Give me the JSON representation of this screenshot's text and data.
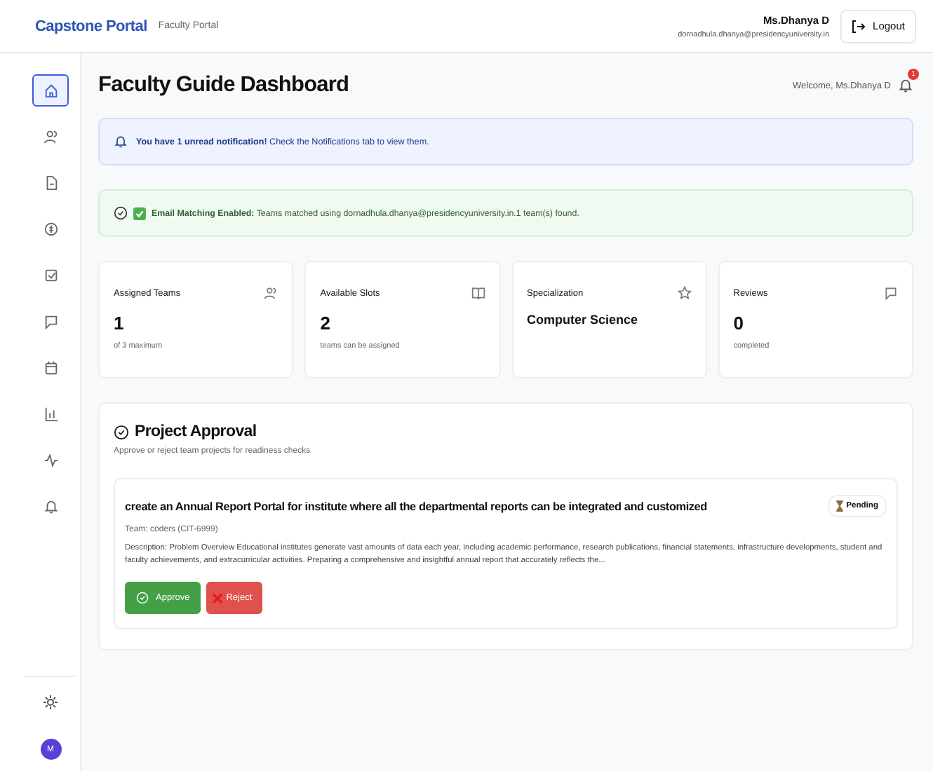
{
  "header": {
    "brand": "Capstone Portal",
    "subtitle": "Faculty Portal",
    "user_name": "Ms.Dhanya D",
    "user_email": "dornadhula.dhanya@presidencyuniversity.in",
    "logout": "Logout"
  },
  "sidebar": {
    "items": [
      {
        "selected": true
      },
      {
        "selected": false
      },
      {
        "selected": false
      },
      {
        "selected": false
      },
      {
        "selected": false
      },
      {
        "selected": false
      },
      {
        "selected": false
      },
      {
        "selected": false
      },
      {
        "selected": false
      },
      {
        "selected": false
      }
    ],
    "avatar": "M"
  },
  "page": {
    "title": "Faculty Guide Dashboard",
    "welcome": "Welcome, Ms.Dhanya D",
    "notification_count": "1"
  },
  "notice": {
    "text": "**You have 1 unread notification!** Check the Notifications tab to view them."
  },
  "email_banner": {
    "text": "**Email Matching Enabled:** Teams matched using dornadhula.dhanya@presidencyuniversity.in.1 team(s) found."
  },
  "stats": [
    {
      "label": "Assigned Teams",
      "value": "1",
      "note": "of 3 maximum"
    },
    {
      "label": "Available Slots",
      "value": "2",
      "note": "teams can be assigned"
    },
    {
      "label": "Specialization",
      "value": "Computer Science"
    },
    {
      "label": "Reviews",
      "value": "0",
      "note": "completed"
    }
  ],
  "approval": {
    "title": "Project Approval",
    "subtitle": "Approve or reject team projects for readiness checks",
    "projects": [
      {
        "title": "create an Annual Report Portal for institute where all the departmental reports can be integrated and customized",
        "status": "Pending",
        "team": "Team: coders (CIT-6999)",
        "description": "Description: Problem Overview Educational institutes generate vast amounts of data each year, including academic performance, research publications, financial statements, infrastructure developments, student and faculty achievements, and extracurricular activities. Preparing a comprehensive and insightful annual report that accurately reflects the...",
        "approve": "Approve",
        "reject": "Reject"
      }
    ]
  }
}
